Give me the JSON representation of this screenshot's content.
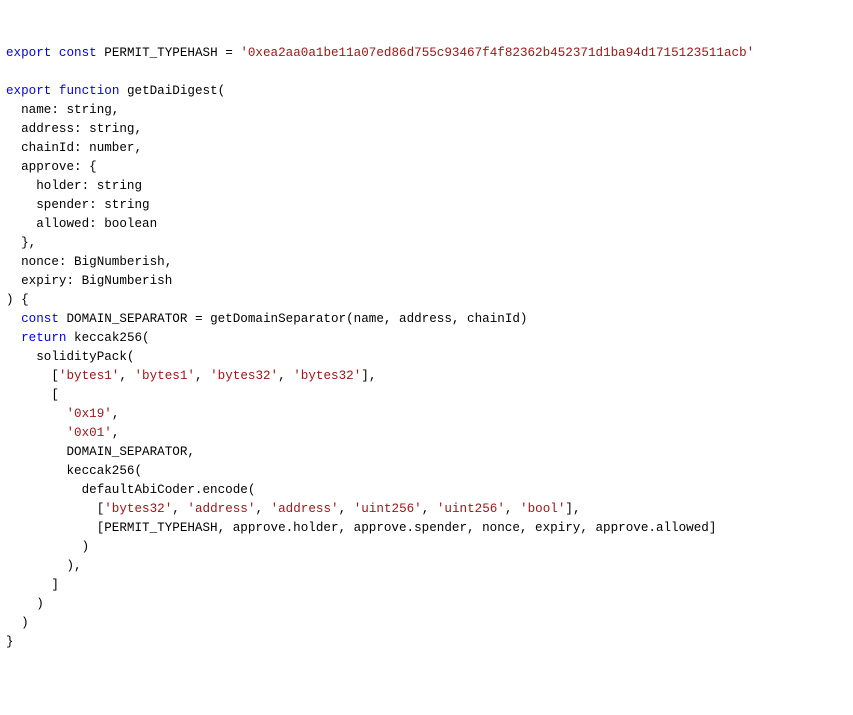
{
  "t": {
    "l1_export": "export",
    "l1_const": "const",
    "l1_rest": " PERMIT_TYPEHASH = ",
    "l1_str": "'0xea2aa0a1be11a07ed86d755c93467f4f82362b452371d1ba94d1715123511acb'",
    "blank": " ",
    "l3_export": "export",
    "l3_function": "function",
    "l3_rest": " getDaiDigest(",
    "l4": "  name: string,",
    "l5": "  address: string,",
    "l6": "  chainId: number,",
    "l7": "  approve: {",
    "l8": "    holder: string",
    "l9": "    spender: string",
    "l10": "    allowed: boolean",
    "l11": "  },",
    "l12": "  nonce: BigNumberish,",
    "l13": "  expiry: BigNumberish",
    "l14": ") {",
    "l15_pre": "  ",
    "l15_const": "const",
    "l15_rest": " DOMAIN_SEPARATOR = getDomainSeparator(name, address, chainId)",
    "l16_pre": "  ",
    "l16_return": "return",
    "l16_rest": " keccak256(",
    "l17": "    solidityPack(",
    "l18_pre": "      [",
    "l18_s1": "'bytes1'",
    "l18_c": ", ",
    "l18_s2": "'bytes1'",
    "l18_s3": "'bytes32'",
    "l18_s4": "'bytes32'",
    "l18_post": "],",
    "l19": "      [",
    "l20_pre": "        ",
    "l20_s": "'0x19'",
    "l20_post": ",",
    "l21_pre": "        ",
    "l21_s": "'0x01'",
    "l21_post": ",",
    "l22": "        DOMAIN_SEPARATOR,",
    "l23": "        keccak256(",
    "l24": "          defaultAbiCoder.encode(",
    "l25_pre": "            [",
    "l25_s1": "'bytes32'",
    "l25_s2": "'address'",
    "l25_s3": "'address'",
    "l25_s4": "'uint256'",
    "l25_s5": "'uint256'",
    "l25_s6": "'bool'",
    "l25_post": "],",
    "l25_c": ", ",
    "l26": "            [PERMIT_TYPEHASH, approve.holder, approve.spender, nonce, expiry, approve.allowed]",
    "l27": "          )",
    "l28": "        ),",
    "l29": "      ]",
    "l30": "    )",
    "l31": "  )",
    "l32": "}"
  }
}
